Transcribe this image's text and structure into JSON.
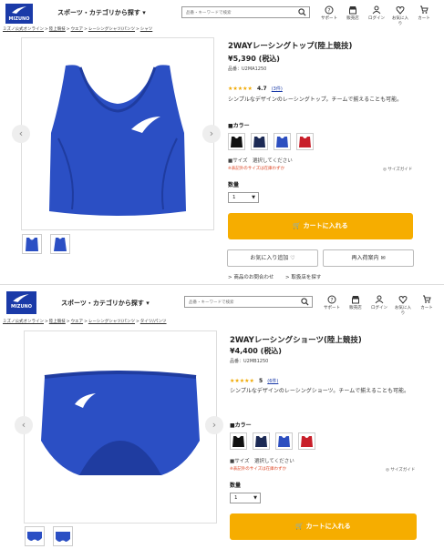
{
  "header": {
    "logo_text": "MIZUNO",
    "category_label": "スポーツ・カテゴリから探す ▾",
    "search_placeholder": "品番・キーワードで検索",
    "icons": [
      {
        "label": "サポート",
        "icon": "help-icon"
      },
      {
        "label": "販売店",
        "icon": "store-icon"
      },
      {
        "label": "ログイン",
        "icon": "user-icon"
      },
      {
        "label": "お気に入り",
        "icon": "heart-icon"
      },
      {
        "label": "カート",
        "icon": "cart-icon"
      }
    ]
  },
  "product1": {
    "breadcrumb": [
      "ミズノ公式オンライン",
      "陸上競技",
      "ウエア",
      "レーシングシャツ/パンツ",
      "シャツ"
    ],
    "title": "2WAYレーシングトップ(陸上競技)",
    "price": "¥5,390 (税込)",
    "sku": "品番：U2MA1250",
    "stars": "★★★★★",
    "rating": "4.7",
    "reviews": "(3件)",
    "description": "シンプルなデザインのレーシングトップ。チームで揃えることも可能。",
    "color_label": "■カラー",
    "colors": [
      "#111111",
      "#1c2a55",
      "#2d4fc0",
      "#c81f2a"
    ],
    "size_label": "■サイズ　選択してください",
    "size_note": "※表記外のサイズは在庫わずか",
    "size_guide": "サイズガイド",
    "qty_label": "数量",
    "qty_value": "1",
    "cart_button": "カートに入れる",
    "favorite_button": "お気に入り追加",
    "restock_button": "再入荷案内",
    "inquiry_link": "> 商品のお問合わせ",
    "store_link": "> 取扱店を探す",
    "image_prev": "‹",
    "image_next": "›"
  },
  "product2": {
    "breadcrumb": [
      "ミズノ公式オンライン",
      "陸上競技",
      "ウエア",
      "レーシングシャツ/パンツ",
      "タイツ/パンツ"
    ],
    "title": "2WAYレーシングショーツ(陸上競技)",
    "price": "¥4,400 (税込)",
    "sku": "品番：U2MB1250",
    "stars": "★★★★★",
    "rating": "5",
    "reviews": "(6件)",
    "description": "シンプルなデザインのレーシングショーツ。チームで揃えることも可能。",
    "color_label": "■カラー",
    "colors": [
      "#111111",
      "#1c2a55",
      "#2d4fc0",
      "#c81f2a"
    ],
    "size_label": "■サイズ　選択してください",
    "size_note": "※表記外のサイズは在庫わずか",
    "size_guide": "サイズガイド",
    "qty_label": "数量",
    "qty_value": "1",
    "cart_button": "カートに入れる",
    "image_prev": "‹",
    "image_next": "›"
  },
  "colors": {
    "brand": "#1a3aa8",
    "cart": "#f6ad00",
    "garment": "#2b4fc4"
  }
}
